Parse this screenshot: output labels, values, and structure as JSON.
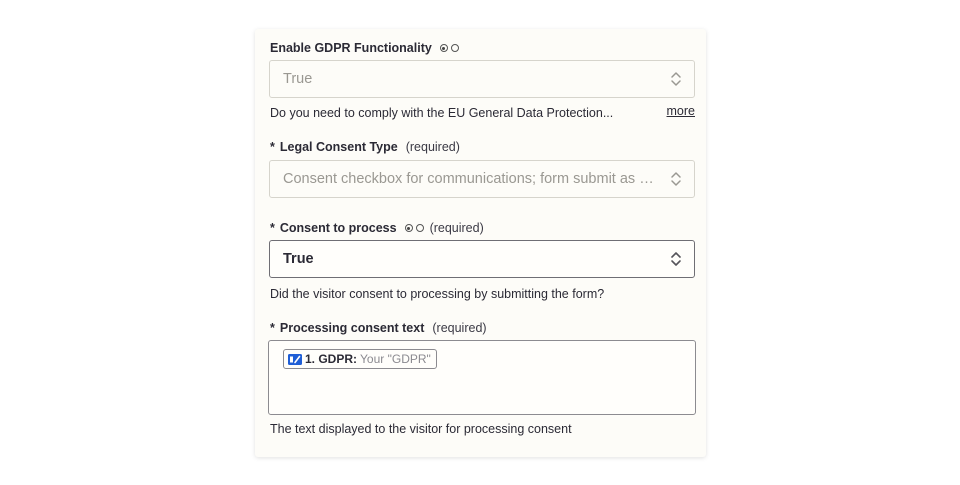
{
  "fields": {
    "gdpr": {
      "label": "Enable GDPR Functionality",
      "value": "True",
      "help": "Do you need to comply with the EU General Data Protection...",
      "more": "more"
    },
    "legal": {
      "star": "*",
      "label": "Legal Consent Type",
      "required": "(required)",
      "value": "Consent checkbox for communications; form submit as consent to process"
    },
    "consent": {
      "star": "*",
      "label": "Consent to process",
      "required": "(required)",
      "value": "True",
      "help": "Did the visitor consent to processing by submitting the form?"
    },
    "text": {
      "star": "*",
      "label": "Processing consent text",
      "required": "(required)",
      "pill_step": "1. GDPR:",
      "pill_value": "Your \"GDPR\"",
      "help": "The text displayed to the visitor for processing consent"
    }
  },
  "icons": {
    "radio": "radio-icon",
    "chevron": "chevron-updown-icon",
    "app": "form-app-icon"
  },
  "colors": {
    "card_bg": "#fdfcf8",
    "text": "#2b2a35",
    "placeholder": "#9a9892",
    "app_icon": "#1f5ed6"
  }
}
